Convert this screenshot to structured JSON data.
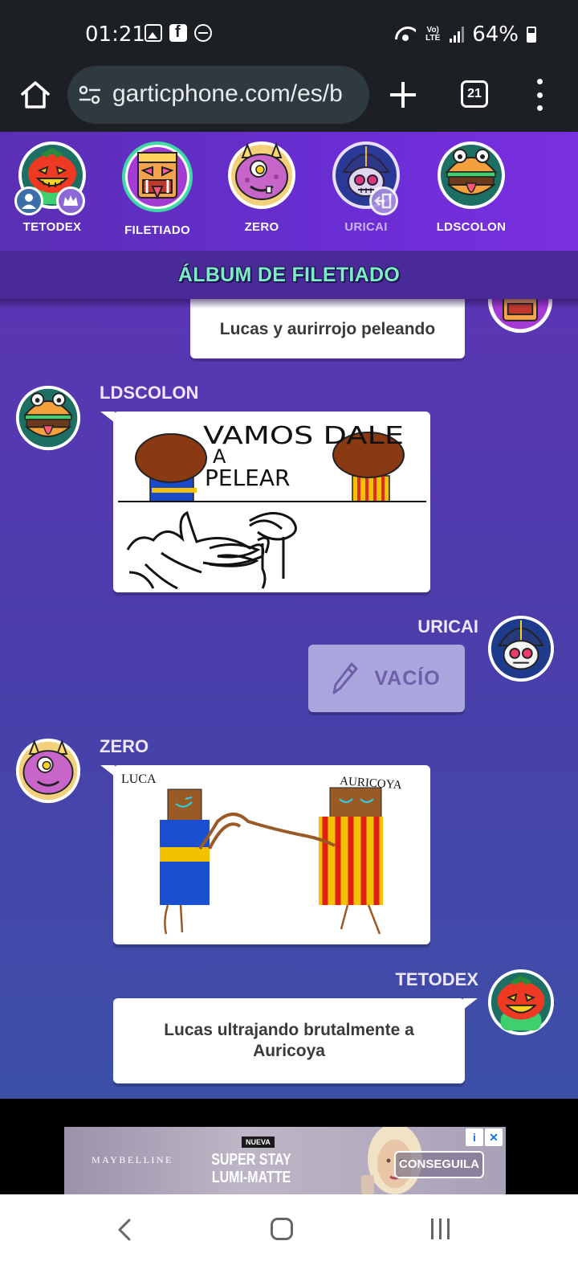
{
  "status_bar": {
    "time": "01:21",
    "network_label": "Vo) LTE",
    "battery": "64%"
  },
  "browser": {
    "url": "garticphone.com/es/b",
    "tab_count": "21"
  },
  "players": [
    {
      "name": "TETODEX",
      "avatar": "tomato-monster"
    },
    {
      "name": "FILETIADO",
      "avatar": "tiki-mask"
    },
    {
      "name": "ZERO",
      "avatar": "pink-cyclops"
    },
    {
      "name": "URICAI",
      "avatar": "skull-sailor"
    },
    {
      "name": "LDSCOLON",
      "avatar": "burger"
    }
  ],
  "album": {
    "title": "ÁLBUM DE FILETIADO"
  },
  "messages": [
    {
      "type": "text",
      "author": "",
      "text": "Lucas y aurirrojo peleando"
    },
    {
      "type": "drawing",
      "author": "LDSCOLON",
      "drawing_text": [
        "VAMOS DALE",
        "A",
        "PELEAR"
      ]
    },
    {
      "type": "empty",
      "author": "URICAI",
      "label": "VACÍO"
    },
    {
      "type": "drawing",
      "author": "ZERO",
      "drawing_text": [
        "LUCA",
        "AURICOYA"
      ]
    },
    {
      "type": "text",
      "author": "TETODEX",
      "text": "Lucas ultrajando brutalmente a Auricoya"
    }
  ],
  "ad": {
    "brand": "MAYBELLINE",
    "tag": "NUEVA",
    "headline": "SUPER STAY LUMI-MATTE",
    "cta": "CONSEGUILA"
  },
  "colors": {
    "players_bg": "#6a2dd4",
    "album_title": "#7dedc4",
    "chat_bg_top": "#5b36b4",
    "chat_bg_bottom": "#3c50a8",
    "empty_bubble": "#aca6de"
  }
}
